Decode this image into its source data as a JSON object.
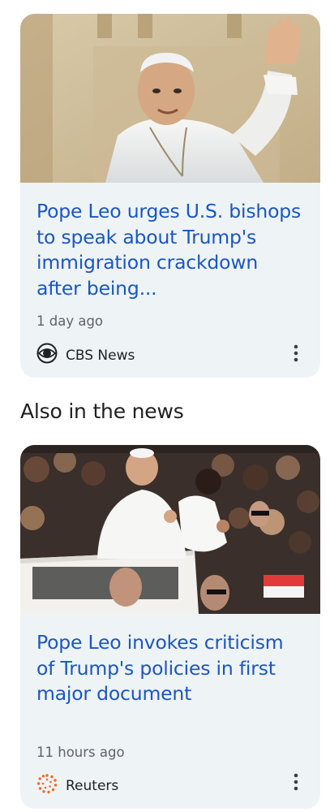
{
  "articles": [
    {
      "headline": "Pope Leo urges U.S. bishops to speak about Trump's immigration crackdown after being...",
      "time": "1 day ago",
      "source": "CBS News",
      "source_icon": "cbs-eye-logo"
    },
    {
      "headline": "Pope Leo invokes criticism of Trump's policies in first major document",
      "time": "11 hours ago",
      "source": "Reuters",
      "source_icon": "reuters-logo"
    }
  ],
  "section": {
    "heading": "Also in the news"
  },
  "colors": {
    "headline": "#1a56c4",
    "card_bg": "#eef3f6",
    "reuters": "#f26b21"
  }
}
